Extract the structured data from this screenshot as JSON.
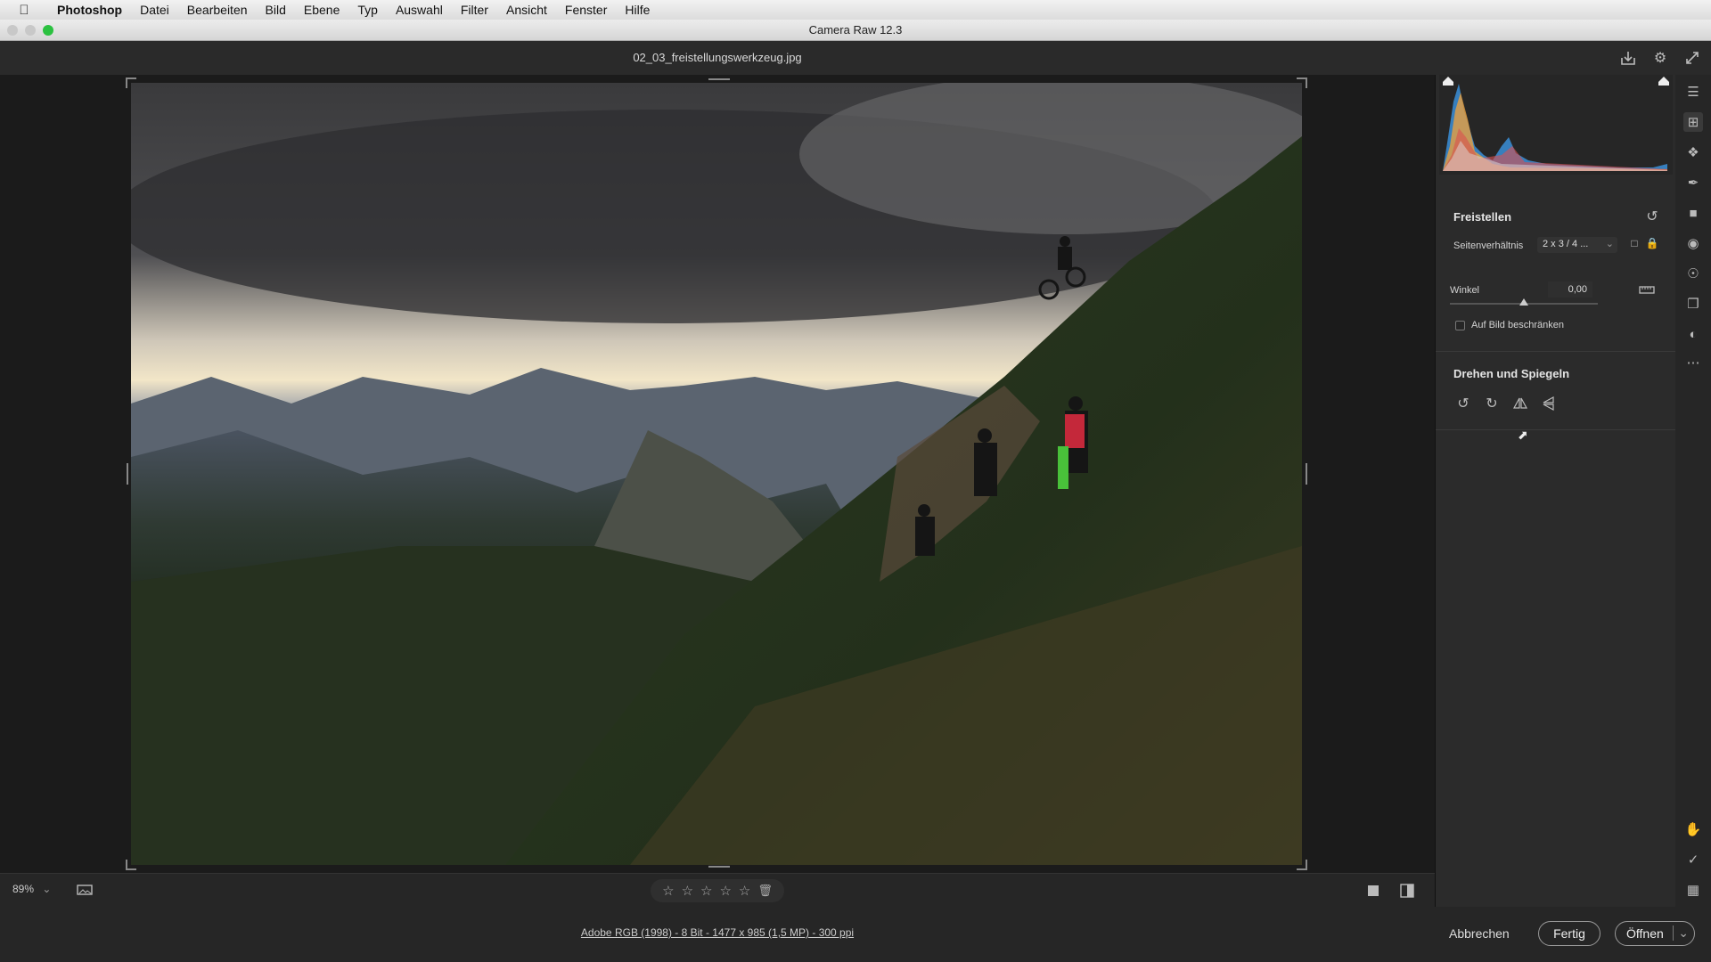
{
  "menubar": {
    "items": [
      "Photoshop",
      "Datei",
      "Bearbeiten",
      "Bild",
      "Ebene",
      "Typ",
      "Auswahl",
      "Filter",
      "Ansicht",
      "Fenster",
      "Hilfe"
    ]
  },
  "window": {
    "title": "Camera Raw 12.3"
  },
  "header": {
    "filename": "02_03_freistellungswerkzeug.jpg"
  },
  "status": {
    "zoom": "89%"
  },
  "panel": {
    "crop": {
      "title": "Freistellen",
      "aspect_label": "Seitenverhältnis",
      "aspect_value": "2 x 3 / 4 ...",
      "angle_label": "Winkel",
      "angle_value": "0,00",
      "angle_slider_position": 0.5,
      "constrain_label": "Auf Bild beschränken",
      "constrain_checked": false
    },
    "rotate": {
      "title": "Drehen und Spiegeln"
    }
  },
  "footer": {
    "meta": "Adobe RGB (1998) - 8 Bit - 1477 x 985 (1,5 MP) - 300 ppi",
    "cancel": "Abbrechen",
    "done": "Fertig",
    "open": "Öffnen"
  },
  "colors": {
    "accent": "#5a8fd8",
    "panel_bg": "#2b2b2b",
    "canvas_bg": "#1b1b1b"
  }
}
